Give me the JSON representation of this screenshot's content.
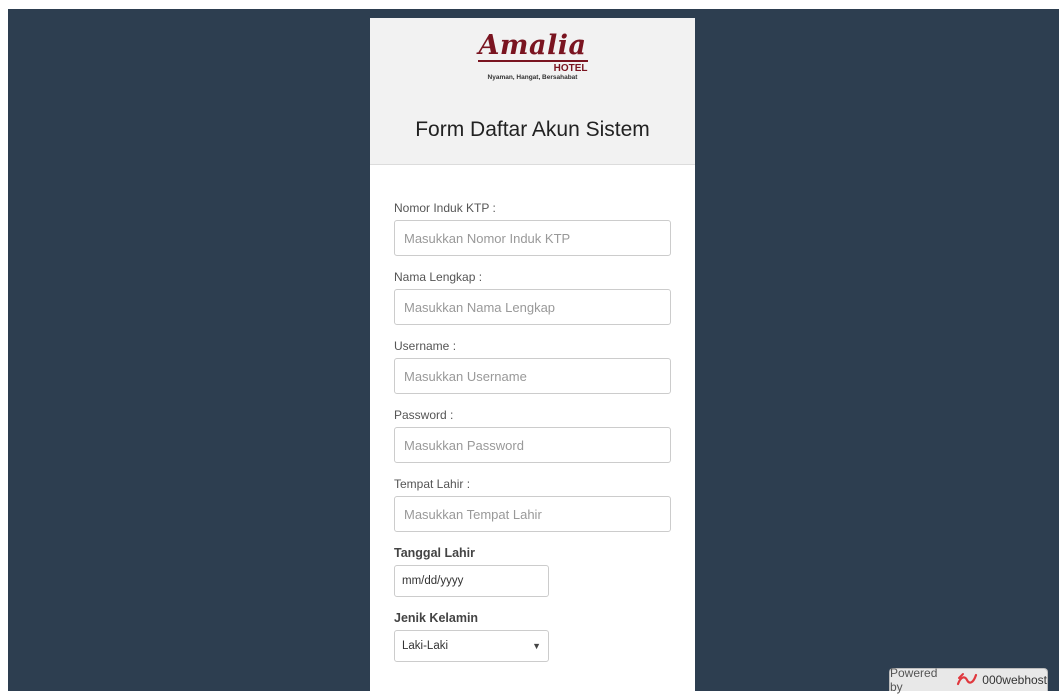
{
  "logo": {
    "wordmark": "Amalia",
    "sub": "HOTEL",
    "tagline": "Nyaman, Hangat, Bersahabat"
  },
  "form": {
    "title": "Form Daftar Akun Sistem",
    "fields": [
      {
        "label": "Nomor Induk KTP :",
        "placeholder": "Masukkan Nomor Induk KTP"
      },
      {
        "label": "Nama Lengkap :",
        "placeholder": "Masukkan Nama Lengkap"
      },
      {
        "label": "Username :",
        "placeholder": "Masukkan Username"
      },
      {
        "label": "Password :",
        "placeholder": "Masukkan Password"
      },
      {
        "label": "Tempat Lahir :",
        "placeholder": "Masukkan Tempat Lahir"
      }
    ],
    "birthdate": {
      "label": "Tanggal Lahir",
      "placeholder": "mm/dd/yyyy"
    },
    "gender": {
      "label": "Jenik Kelamin",
      "selected": "Laki-Laki"
    }
  },
  "badge": {
    "prefix": "Powered by",
    "brand": "000webhost",
    "icon": "webhost-logo-icon"
  },
  "colors": {
    "page_background": "#2d3e50",
    "card_header": "#f2f2f2",
    "brand": "#7a1420",
    "badge_icon": "#e0383e"
  }
}
